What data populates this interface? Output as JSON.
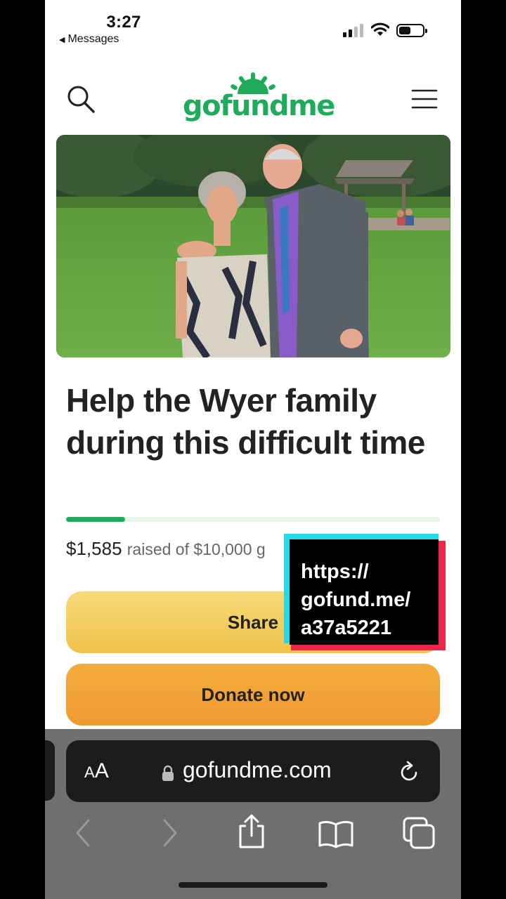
{
  "status_bar": {
    "time": "3:27",
    "back_label": "Messages"
  },
  "header": {
    "logo_text": "gofundme",
    "search_icon": "search-icon",
    "menu_icon": "hamburger-menu-icon"
  },
  "campaign": {
    "title": "Help the Wyer family during this difficult time",
    "raised_amount": "$1,585",
    "raised_text": "raised of $10,000 g",
    "progress_fraction": 0.1585
  },
  "actions": {
    "share_label": "Share",
    "donate_label": "Donate now"
  },
  "overlay": {
    "lines": [
      "https://",
      "gofund.me/",
      "a37a5221"
    ]
  },
  "browser": {
    "text_size_label": "AA",
    "url": "gofundme.com"
  },
  "colors": {
    "brand_green": "#1fab5b",
    "share_yellow": "#f0c24a",
    "donate_orange": "#f09a33"
  }
}
